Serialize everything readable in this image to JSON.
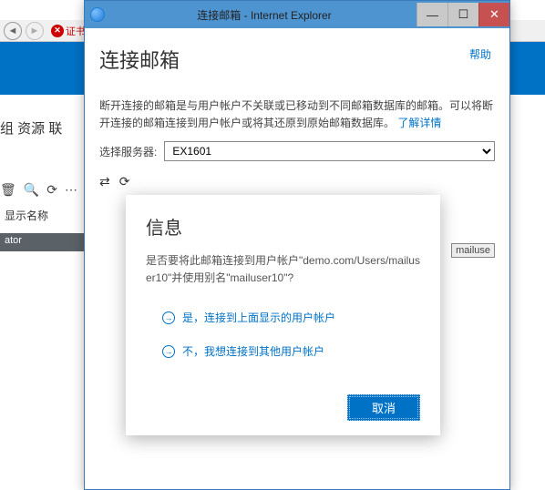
{
  "bg": {
    "cert_error": "证书错",
    "nav_labels": "组  资源  联",
    "search_label": "显示名称",
    "row_label": "ator",
    "partial_user": "mailuse"
  },
  "window": {
    "title": "连接邮箱 - Internet Explorer",
    "help": "帮助",
    "heading": "连接邮箱",
    "desc_pre": "断开连接的邮箱是与用户帐户不关联或已移动到不同邮箱数据库的邮箱。可以将断开连接的邮箱连接到用户帐户或将其还原到原始邮箱数据库。",
    "learn_more": "了解详情",
    "server_label": "选择服务器:",
    "server_value": "EX1601"
  },
  "modal": {
    "title": "信息",
    "message": "是否要将此邮箱连接到用户帐户\"demo.com/Users/mailuser10\"并使用别名\"mailuser10\"?",
    "opt_yes": "是，连接到上面显示的用户帐户",
    "opt_no": "不，我想连接到其他用户帐户",
    "cancel": "取消"
  }
}
